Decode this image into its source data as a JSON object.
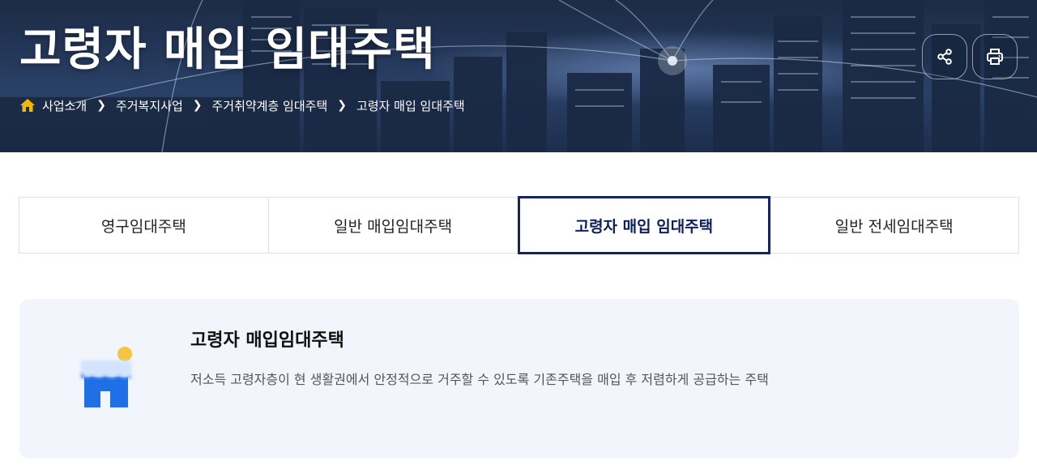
{
  "hero": {
    "title": "고령자 매입 임대주택",
    "breadcrumb": [
      "사업소개",
      "주거복지사업",
      "주거취약계층 임대주택",
      "고령자 매입 임대주택"
    ],
    "buttons": {
      "share_icon": "share-icon",
      "print_icon": "print-icon"
    }
  },
  "tabs": [
    {
      "label": "영구임대주택",
      "active": false
    },
    {
      "label": "일반 매입임대주택",
      "active": false
    },
    {
      "label": "고령자 매입 임대주택",
      "active": true
    },
    {
      "label": "일반 전세임대주택",
      "active": false
    }
  ],
  "info": {
    "icon": "house-icon",
    "title": "고령자 매입임대주택",
    "description": "저소득 고령자층이 현 생활권에서 안정적으로 거주할 수 있도록 기존주택을 매입 후 저렴하게 공급하는 주택"
  },
  "colors": {
    "active_tab_border": "#162463",
    "home_icon": "#f5b800",
    "card_background": "#f2f5fb",
    "house_icon_blue": "#1f6fe6",
    "sun_yellow": "#f6c343"
  }
}
